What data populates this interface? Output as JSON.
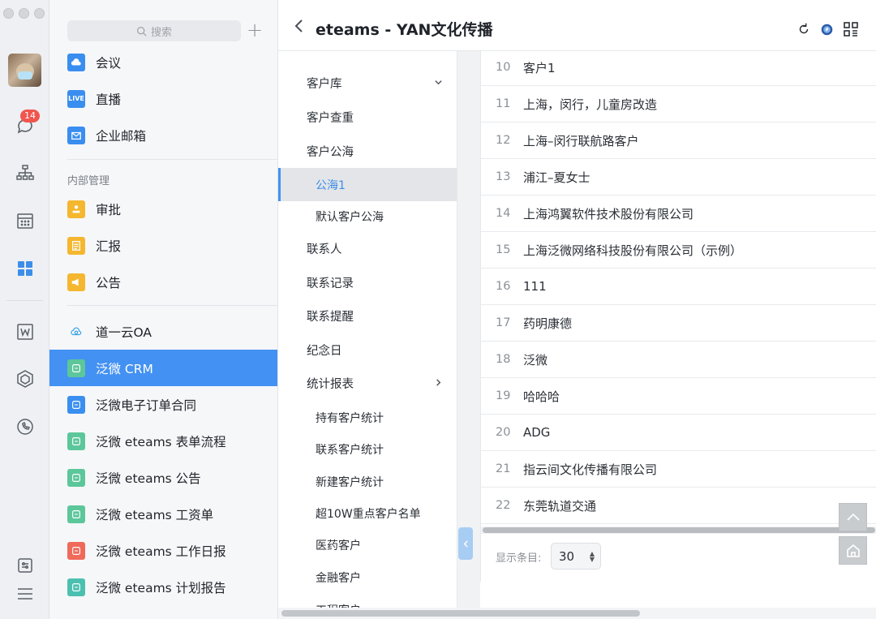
{
  "window": {
    "title": "eteams - YAN文化传播"
  },
  "rail": {
    "chat_badge": "14",
    "icons": [
      "chat-icon",
      "org-chart-icon",
      "calendar-icon",
      "apps-grid-icon",
      "word-doc-icon",
      "box-icon",
      "phone-icon",
      "settings-icon",
      "menu-icon"
    ]
  },
  "applist": {
    "search_placeholder": "搜索",
    "items_top": [
      {
        "label": "会议",
        "icon": "cloud-meeting-icon",
        "color": "#3a8ef0"
      },
      {
        "label": "直播",
        "icon": "live-icon",
        "color": "#3a8ef0",
        "icon_text": "LIVE"
      },
      {
        "label": "企业邮箱",
        "icon": "mail-icon",
        "color": "#3a8ef0"
      }
    ],
    "section_label": "内部管理",
    "items_internal": [
      {
        "label": "审批",
        "icon": "approval-icon",
        "color": "#f5b730"
      },
      {
        "label": "汇报",
        "icon": "report-icon",
        "color": "#f5b730"
      },
      {
        "label": "公告",
        "icon": "announce-icon",
        "color": "#f5b730"
      }
    ],
    "items_apps": [
      {
        "label": "道一云OA",
        "icon": "cloud-oa-icon",
        "color": "#3aa6e8"
      },
      {
        "label": "泛微 CRM",
        "icon": "crm-icon",
        "color": "#5cc79a",
        "active": true
      },
      {
        "label": "泛微电子订单合同",
        "icon": "contract-icon",
        "color": "#3a8ef0"
      },
      {
        "label": "泛微 eteams 表单流程",
        "icon": "form-flow-icon",
        "color": "#5cc79a"
      },
      {
        "label": "泛微 eteams 公告",
        "icon": "eteams-announce-icon",
        "color": "#5cc79a"
      },
      {
        "label": "泛微 eteams 工资单",
        "icon": "salary-icon",
        "color": "#5cc79a"
      },
      {
        "label": "泛微 eteams 工作日报",
        "icon": "daily-report-icon",
        "color": "#f06a5a"
      },
      {
        "label": "泛微 eteams 计划报告",
        "icon": "plan-report-icon",
        "color": "#4cc0b0"
      }
    ]
  },
  "submenu": {
    "items": [
      {
        "label": "客户库",
        "chevron": "down"
      },
      {
        "label": "客户查重"
      },
      {
        "label": "客户公海"
      },
      {
        "label": "公海1",
        "sub": true,
        "active": true
      },
      {
        "label": "默认客户公海",
        "sub": true
      },
      {
        "label": "联系人"
      },
      {
        "label": "联系记录"
      },
      {
        "label": "联系提醒"
      },
      {
        "label": "纪念日"
      },
      {
        "label": "统计报表",
        "chevron": "right"
      },
      {
        "label": "持有客户统计",
        "sub": true
      },
      {
        "label": "联系客户统计",
        "sub": true
      },
      {
        "label": "新建客户统计",
        "sub": true
      },
      {
        "label": "超10W重点客户名单",
        "sub": true
      },
      {
        "label": "医药客户",
        "sub": true
      },
      {
        "label": "金融客户",
        "sub": true
      },
      {
        "label": "工程客户",
        "sub": true
      }
    ]
  },
  "table": {
    "rows": [
      {
        "num": "10",
        "name": "客户1"
      },
      {
        "num": "11",
        "name": "上海，闵行，儿童房改造"
      },
      {
        "num": "12",
        "name": "上海–闵行联航路客户"
      },
      {
        "num": "13",
        "name": "浦江–夏女士"
      },
      {
        "num": "14",
        "name": "上海鸿翼软件技术股份有限公司"
      },
      {
        "num": "15",
        "name": "上海泛微网络科技股份有限公司（示例）"
      },
      {
        "num": "16",
        "name": "111"
      },
      {
        "num": "17",
        "name": "药明康德"
      },
      {
        "num": "18",
        "name": "泛微"
      },
      {
        "num": "19",
        "name": "哈哈哈"
      },
      {
        "num": "20",
        "name": "ADG"
      },
      {
        "num": "21",
        "name": "指云间文化传播有限公司"
      },
      {
        "num": "22",
        "name": "东莞轨道交通"
      }
    ],
    "page_size_label": "显示条目:",
    "page_size_value": "30"
  }
}
